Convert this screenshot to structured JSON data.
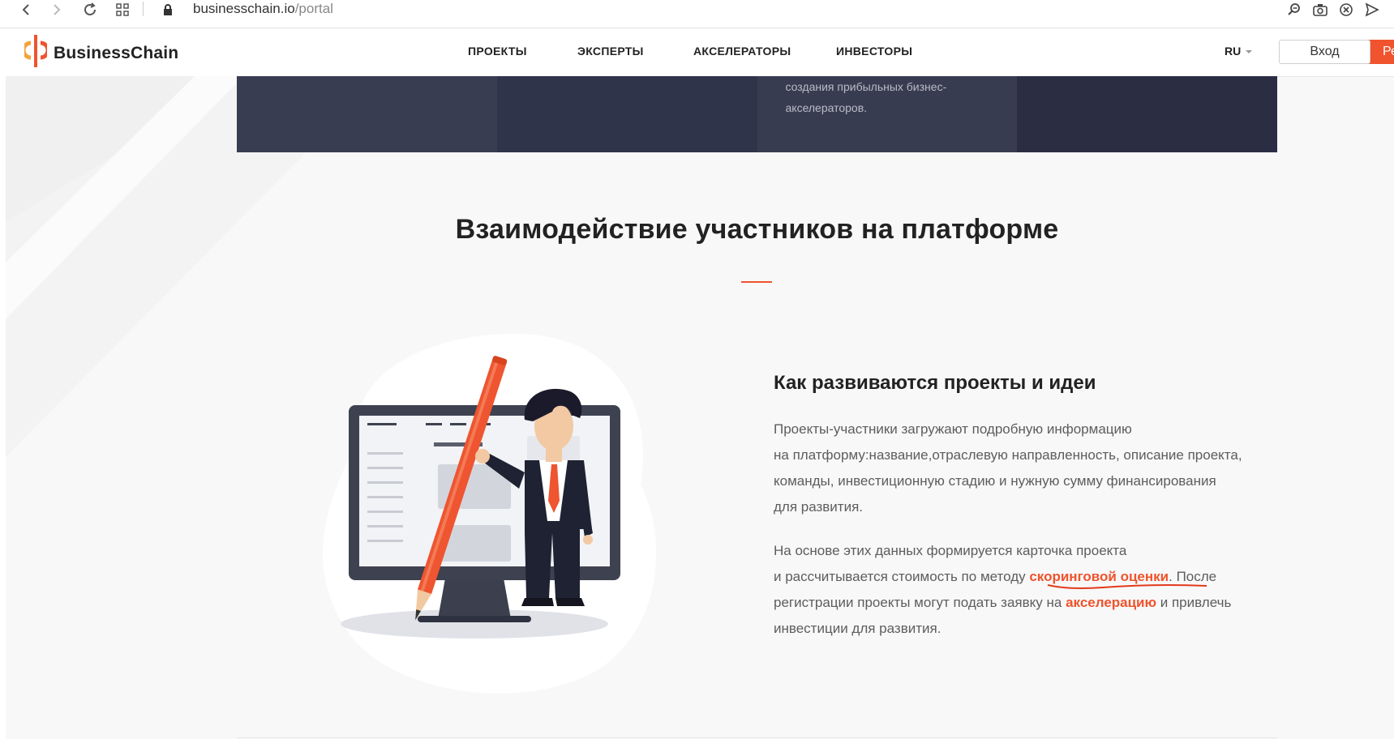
{
  "browser": {
    "url_domain": "businesschain.io",
    "url_path": "/portal"
  },
  "header": {
    "logo_text": "BusinessChain",
    "nav": [
      "ПРОЕКТЫ",
      "ЭКСПЕРТЫ",
      "АКСЕЛЕРАТОРЫ",
      "ИНВЕСТОРЫ"
    ],
    "lang": "RU",
    "login_label": "Вход",
    "register_label": "Ре"
  },
  "banner": {
    "text_line1": "создания прибыльных бизнес-",
    "text_line2": "акселераторов."
  },
  "section": {
    "title": "Взаимодействие участников на платформе",
    "heading": "Как развиваются проекты и идеи",
    "p1_lines": [
      "Проекты-участники загружают подробную информацию",
      "на платформу:название,отраслевую направленность, описание проекта,",
      "команды, инвестиционную стадию и нужную сумму финансирования",
      "для развития."
    ],
    "p2_line1": "На основе этих данных формируется карточка проекта",
    "p2_line2_a": "и рассчитывается стоимость по методу ",
    "p2_link1": "скоринговой оценки",
    "p2_line2_b": ". После",
    "p2_line3_a": "регистрации проекты могут подать заявку на ",
    "p2_link2": "акселерацию",
    "p2_line3_b": " и привлечь",
    "p2_line4": "инвестиции для развития."
  },
  "colors": {
    "accent": "#f0532d",
    "dark_banner": "#30344a",
    "text_muted": "#5d5d5d"
  }
}
